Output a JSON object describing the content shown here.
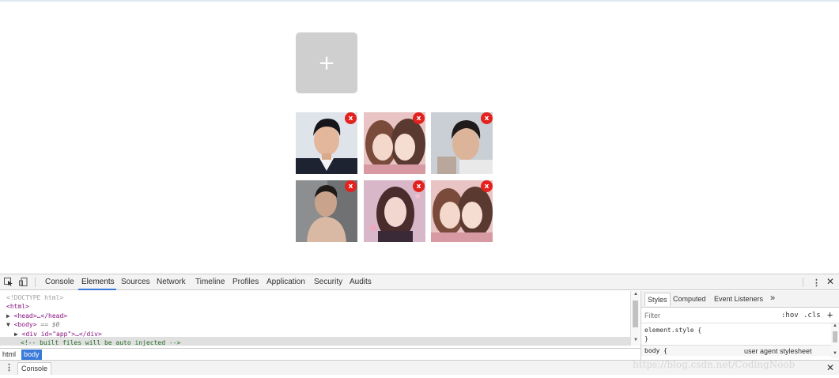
{
  "page": {
    "add_symbol": "+",
    "delete_label": "x",
    "thumbnail_count": 6
  },
  "devtools": {
    "tabs": [
      "Console",
      "Elements",
      "Sources",
      "Network",
      "Timeline",
      "Profiles",
      "Application",
      "Security",
      "Audits"
    ],
    "active_tab": "Elements",
    "menu_glyph": "⋮",
    "close_glyph": "✕",
    "accent_color": "#3879d9"
  },
  "elements": {
    "lines": [
      "<!DOCTYPE html>",
      "<html>",
      "<head>…</head>",
      "<body>",
      "<div id=\"app\">…</div>",
      "<!-- built files will be auto injected -->"
    ],
    "selected_marker": "== $0",
    "collapsed_glyph": "▶",
    "expanded_glyph": "▼",
    "scroll_up": "▲",
    "scroll_down": "▼",
    "breadcrumbs": [
      "html",
      "body"
    ]
  },
  "styles": {
    "tabs": [
      "Styles",
      "Computed",
      "Event Listeners"
    ],
    "more_glyph": "»",
    "filter_placeholder": "Filter",
    "hov": ":hov",
    "cls": ".cls",
    "add_glyph": "+",
    "rules": [
      "element.style {",
      "}",
      "body {"
    ],
    "source": "user agent stylesheet"
  },
  "drawer": {
    "tab": "Console"
  },
  "watermark": "https://blog.csdn.net/CodingNoob"
}
